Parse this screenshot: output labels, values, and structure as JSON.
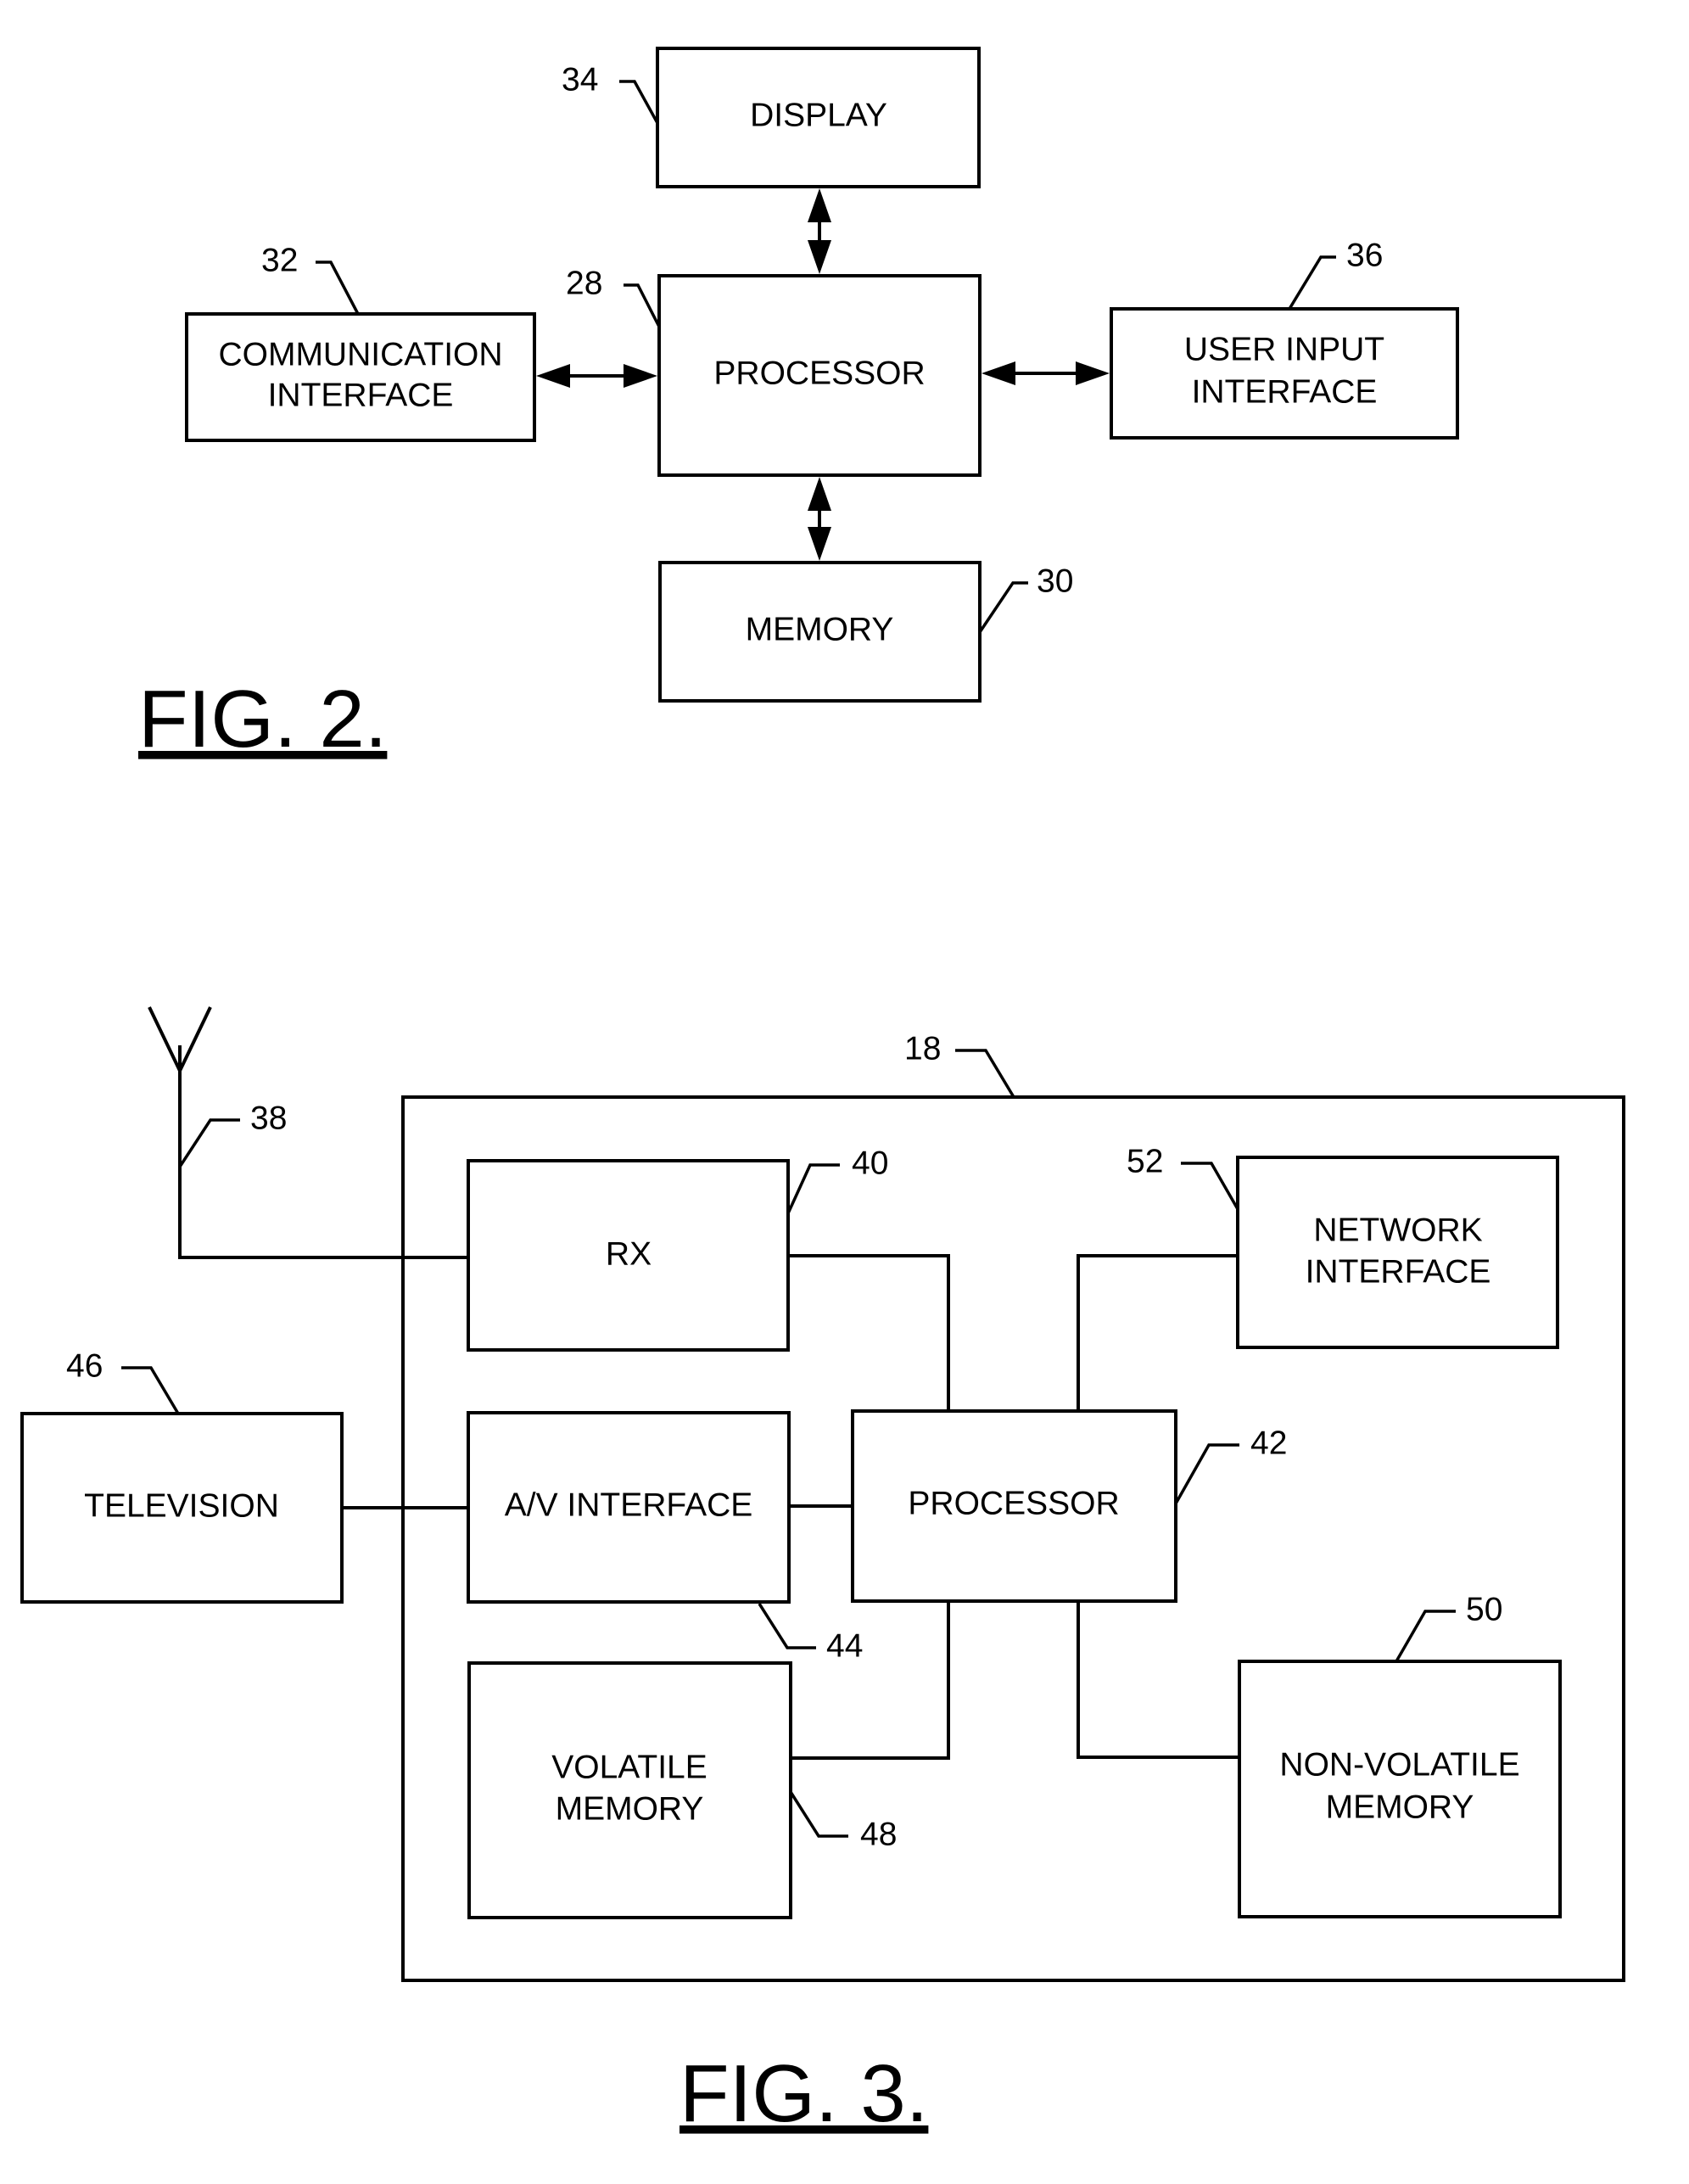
{
  "fig2": {
    "caption": "FIG. 2.",
    "display": {
      "label": "DISPLAY",
      "ref": "34"
    },
    "processor": {
      "label": "PROCESSOR",
      "ref": "28"
    },
    "communication_interface": {
      "line1": "COMMUNICATION",
      "line2": "INTERFACE",
      "ref": "32"
    },
    "user_input_interface": {
      "line1": "USER INPUT",
      "line2": "INTERFACE",
      "ref": "36"
    },
    "memory": {
      "label": "MEMORY",
      "ref": "30"
    }
  },
  "fig3": {
    "caption": "FIG. 3.",
    "device": {
      "ref": "18"
    },
    "antenna": {
      "ref": "38"
    },
    "rx": {
      "label": "RX",
      "ref": "40"
    },
    "network_interface": {
      "line1": "NETWORK",
      "line2": "INTERFACE",
      "ref": "52"
    },
    "television": {
      "label": "TELEVISION",
      "ref": "46"
    },
    "av_interface": {
      "label": "A/V INTERFACE",
      "ref": "44"
    },
    "processor": {
      "label": "PROCESSOR",
      "ref": "42"
    },
    "volatile_memory": {
      "line1": "VOLATILE",
      "line2": "MEMORY",
      "ref": "48"
    },
    "non_volatile_memory": {
      "line1": "NON-VOLATILE",
      "line2": "MEMORY",
      "ref": "50"
    }
  }
}
